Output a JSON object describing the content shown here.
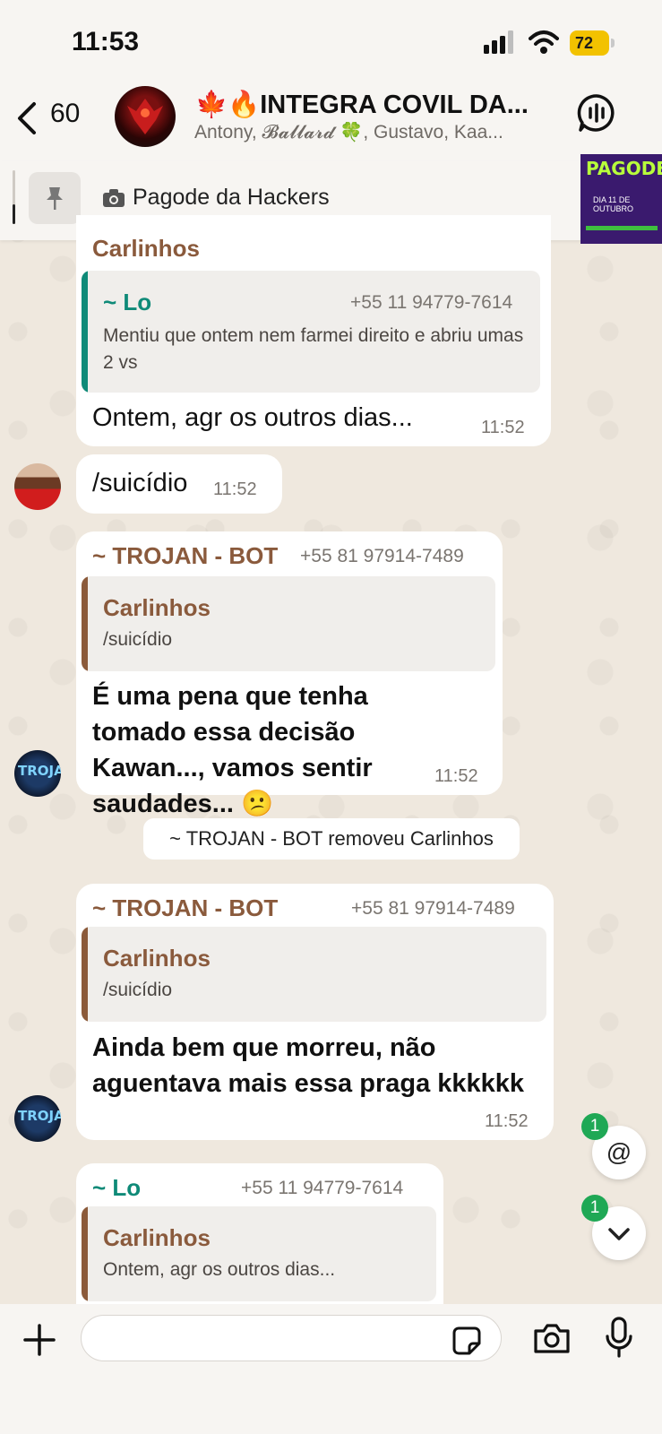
{
  "status_bar": {
    "time": "11:53",
    "battery": "72"
  },
  "header": {
    "back_count": "60",
    "title": "🍁🔥INTEGRA COVIL DA...",
    "members": "Antony, 𝓑𝓪𝓵𝓵𝓪𝓻𝓭 🍀, Gustavo, Kaa..."
  },
  "pinned": {
    "text": "Pagode da Hackers",
    "thumb_title": "PAGODE",
    "thumb_sub": "DIA 11 DE OUTUBRO"
  },
  "messages": [
    {
      "sender": "Carlinhos",
      "quote_author": "~ Lo",
      "quote_phone": "+55 11 94779-7614",
      "quote_text": "Mentiu que ontem nem farmei direito e abriu umas 2 vs",
      "text": "Ontem, agr os outros dias...",
      "time": "11:52"
    },
    {
      "text": "/suicídio",
      "time": "11:52"
    },
    {
      "sender": "~ TROJAN - BOT",
      "phone": "+55 81 97914-7489",
      "quote_author": "Carlinhos",
      "quote_text": "/suicídio",
      "text": "É uma pena que tenha tomado essa decisão Kawan..., vamos sentir saudades... 😕",
      "time": "11:52"
    },
    {
      "sender": "~ TROJAN - BOT",
      "phone": "+55 81 97914-7489",
      "quote_author": "Carlinhos",
      "quote_text": "/suicídio",
      "text": "Ainda bem que morreu, não aguentava mais essa praga kkkkkk",
      "time": "11:52"
    },
    {
      "sender": "~ Lo",
      "phone": "+55 11 94779-7614",
      "quote_author": "Carlinhos",
      "quote_text": "Ontem, agr os outros dias..."
    }
  ],
  "system_message": "~ TROJAN - BOT removeu Carlinhos",
  "bot_avatar_label": "TROJAN",
  "fabs": {
    "mention_label": "@",
    "mention_badge": "1",
    "scroll_badge": "1"
  },
  "composer": {
    "placeholder": "",
    "value": ""
  },
  "colors": {
    "accent_green": "#1fa855",
    "lo_teal": "#0f8a78",
    "brown_name": "#8a5a3c",
    "brown_quote": "#8b5a3a"
  }
}
